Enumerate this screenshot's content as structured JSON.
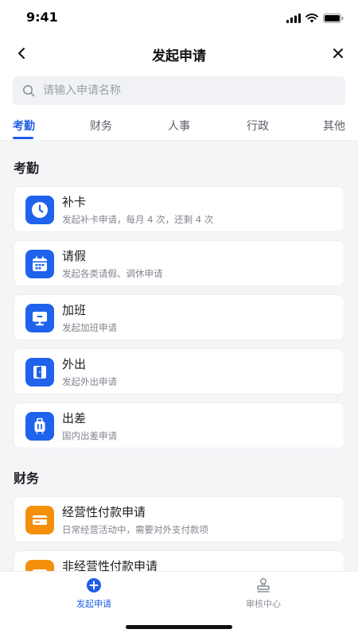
{
  "status_bar": {
    "time": "9:41"
  },
  "nav": {
    "title": "发起申请"
  },
  "search": {
    "placeholder": "请输入申请名称",
    "value": ""
  },
  "tabs": [
    {
      "label": "考勤",
      "active": true
    },
    {
      "label": "财务",
      "active": false
    },
    {
      "label": "人事",
      "active": false
    },
    {
      "label": "行政",
      "active": false
    },
    {
      "label": "其他",
      "active": false
    }
  ],
  "sections": [
    {
      "title": "考勤",
      "items": [
        {
          "title": "补卡",
          "desc": "发起补卡申请，每月 4 次，还剩 4 次",
          "icon": "clock-icon",
          "color": "#1f63ec"
        },
        {
          "title": "请假",
          "desc": "发起各类请假、调休申请",
          "icon": "calendar-icon",
          "color": "#1f63ec"
        },
        {
          "title": "加班",
          "desc": "发起加班申请",
          "icon": "monitor-icon",
          "color": "#1f63ec"
        },
        {
          "title": "外出",
          "desc": "发起外出申请",
          "icon": "door-exit-icon",
          "color": "#1f63ec"
        },
        {
          "title": "出差",
          "desc": "国内出差申请",
          "icon": "suitcase-icon",
          "color": "#1f63ec"
        }
      ]
    },
    {
      "title": "财务",
      "items": [
        {
          "title": "经营性付款申请",
          "desc": "日常经营活动中，需要对外支付款项",
          "icon": "card-icon",
          "color": "#f4900c"
        },
        {
          "title": "非经营性付款申请",
          "desc": "",
          "icon": "card-icon",
          "color": "#f4900c"
        }
      ]
    }
  ],
  "tabbar": [
    {
      "label": "发起申请",
      "icon": "plus-circle-icon",
      "active": true
    },
    {
      "label": "审核中心",
      "icon": "stamp-icon",
      "active": false
    }
  ],
  "colors": {
    "accent": "#1f5fe8",
    "orange": "#f4900c",
    "background": "#f4f5f7"
  }
}
